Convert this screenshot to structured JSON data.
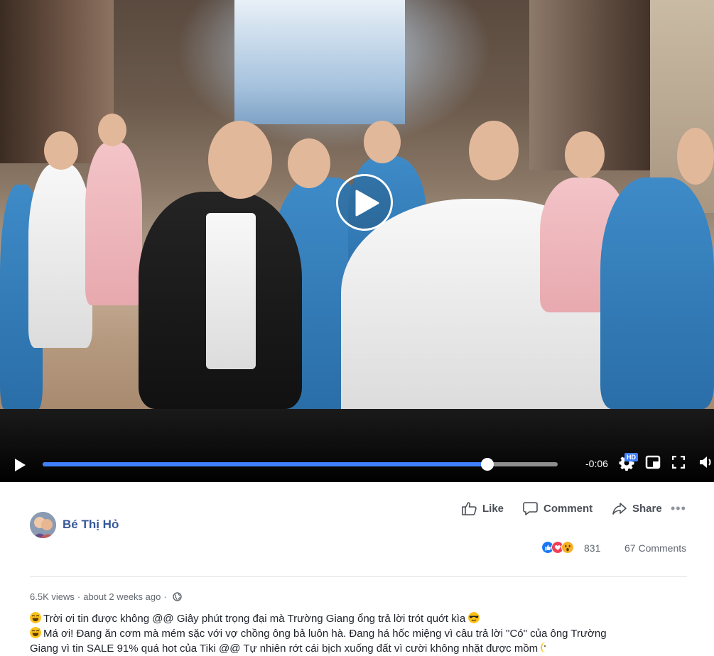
{
  "video": {
    "time_remaining": "-0:06",
    "progress_fraction": 0.864,
    "quality_badge": "HD",
    "icons": [
      "play-icon",
      "settings-icon",
      "picture-in-picture-icon",
      "fullscreen-icon",
      "volume-icon"
    ]
  },
  "post": {
    "author": "Bé Thị Hỏ",
    "actions": {
      "like": "Like",
      "comment": "Comment",
      "share": "Share",
      "more": "•••"
    },
    "reactions": {
      "types": [
        "like",
        "love",
        "wow"
      ],
      "count": "831"
    },
    "comments_count": "67 Comments",
    "meta": {
      "views": "6.5K views",
      "separator": "·",
      "time": "about 2 weeks ago",
      "privacy_icon": "globe-icon"
    },
    "caption": {
      "line1": "Trời ơi tin được không @@ Giây phút trọng đại mà Trường Giang ổng trả lời trót quớt kìa",
      "line2": "Má ơi! Đang ăn cơm mà mém sặc với vợ chồng ông bả luôn hà. Đang há hốc miệng vì câu trả lời \"Có\" của ông Trường",
      "line3": "Giang vì tin SALE 91% quá hot của Tiki @@ Tự nhiên rớt cái bịch xuống đất vì cười không nhặt được mồm"
    }
  },
  "colors": {
    "link": "#365899",
    "progress": "#4080ff",
    "text_secondary": "#616770"
  }
}
